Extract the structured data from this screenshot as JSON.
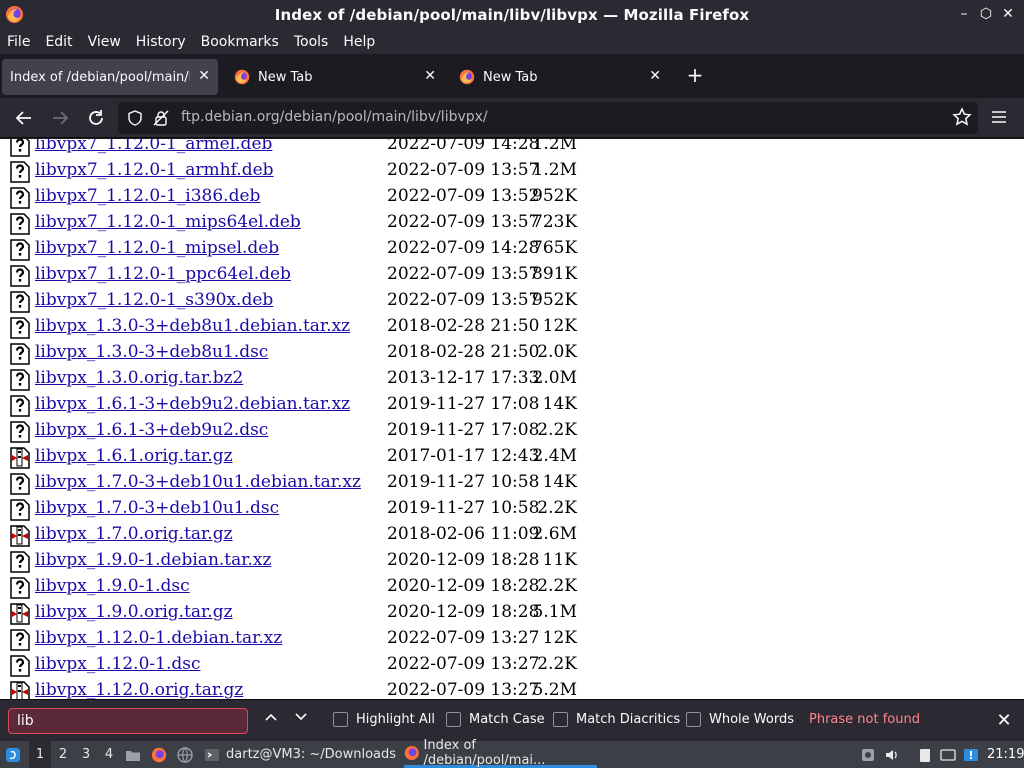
{
  "window": {
    "title": "Index of /debian/pool/main/libv/libvpx — Mozilla Firefox",
    "controls": [
      "–",
      "⬡",
      "✕"
    ]
  },
  "menu": [
    "File",
    "Edit",
    "View",
    "History",
    "Bookmarks",
    "Tools",
    "Help"
  ],
  "tabs": [
    {
      "label": "Index of /debian/pool/main/libv",
      "active": true
    },
    {
      "label": "New Tab",
      "active": false
    },
    {
      "label": "New Tab",
      "active": false
    }
  ],
  "urlbar": {
    "host": "ftp.debian.org",
    "path": "/debian/pool/main/libv/libvpx/"
  },
  "listing": [
    {
      "name": "libvpx7_1.12.0-1_armel.deb",
      "date": "2022-07-09 14:28",
      "size": "1.2M",
      "type": "unknown"
    },
    {
      "name": "libvpx7_1.12.0-1_armhf.deb",
      "date": "2022-07-09 13:57",
      "size": "1.2M",
      "type": "unknown"
    },
    {
      "name": "libvpx7_1.12.0-1_i386.deb",
      "date": "2022-07-09 13:52",
      "size": "952K",
      "type": "unknown"
    },
    {
      "name": "libvpx7_1.12.0-1_mips64el.deb",
      "date": "2022-07-09 13:57",
      "size": "723K",
      "type": "unknown"
    },
    {
      "name": "libvpx7_1.12.0-1_mipsel.deb",
      "date": "2022-07-09 14:28",
      "size": "765K",
      "type": "unknown"
    },
    {
      "name": "libvpx7_1.12.0-1_ppc64el.deb",
      "date": "2022-07-09 13:57",
      "size": "891K",
      "type": "unknown"
    },
    {
      "name": "libvpx7_1.12.0-1_s390x.deb",
      "date": "2022-07-09 13:57",
      "size": "952K",
      "type": "unknown"
    },
    {
      "name": "libvpx_1.3.0-3+deb8u1.debian.tar.xz",
      "date": "2018-02-28 21:50",
      "size": "12K",
      "type": "unknown"
    },
    {
      "name": "libvpx_1.3.0-3+deb8u1.dsc",
      "date": "2018-02-28 21:50",
      "size": "2.0K",
      "type": "unknown"
    },
    {
      "name": "libvpx_1.3.0.orig.tar.bz2",
      "date": "2013-12-17 17:33",
      "size": "2.0M",
      "type": "unknown"
    },
    {
      "name": "libvpx_1.6.1-3+deb9u2.debian.tar.xz",
      "date": "2019-11-27 17:08",
      "size": "14K",
      "type": "unknown"
    },
    {
      "name": "libvpx_1.6.1-3+deb9u2.dsc",
      "date": "2019-11-27 17:08",
      "size": "2.2K",
      "type": "unknown"
    },
    {
      "name": "libvpx_1.6.1.orig.tar.gz",
      "date": "2017-01-17 12:43",
      "size": "2.4M",
      "type": "archive"
    },
    {
      "name": "libvpx_1.7.0-3+deb10u1.debian.tar.xz",
      "date": "2019-11-27 10:58",
      "size": "14K",
      "type": "unknown"
    },
    {
      "name": "libvpx_1.7.0-3+deb10u1.dsc",
      "date": "2019-11-27 10:58",
      "size": "2.2K",
      "type": "unknown"
    },
    {
      "name": "libvpx_1.7.0.orig.tar.gz",
      "date": "2018-02-06 11:09",
      "size": "2.6M",
      "type": "archive"
    },
    {
      "name": "libvpx_1.9.0-1.debian.tar.xz",
      "date": "2020-12-09 18:28",
      "size": "11K",
      "type": "unknown"
    },
    {
      "name": "libvpx_1.9.0-1.dsc",
      "date": "2020-12-09 18:28",
      "size": "2.2K",
      "type": "unknown"
    },
    {
      "name": "libvpx_1.9.0.orig.tar.gz",
      "date": "2020-12-09 18:28",
      "size": "5.1M",
      "type": "archive"
    },
    {
      "name": "libvpx_1.12.0-1.debian.tar.xz",
      "date": "2022-07-09 13:27",
      "size": "12K",
      "type": "unknown"
    },
    {
      "name": "libvpx_1.12.0-1.dsc",
      "date": "2022-07-09 13:27",
      "size": "2.2K",
      "type": "unknown"
    },
    {
      "name": "libvpx_1.12.0.orig.tar.gz",
      "date": "2022-07-09 13:27",
      "size": "5.2M",
      "type": "archive"
    }
  ],
  "findbar": {
    "query": "lib",
    "options": [
      "Highlight All",
      "Match Case",
      "Match Diacritics",
      "Whole Words"
    ],
    "status": "Phrase not found"
  },
  "taskbar": {
    "workspaces": [
      "1",
      "2",
      "3",
      "4"
    ],
    "windows": [
      {
        "label": "dartz@VM3: ~/Downloads",
        "active": false
      },
      {
        "label": "Index of /debian/pool/mai...",
        "active": true
      }
    ],
    "clock": "21:19"
  },
  "colors": {
    "link": "#1b0ba6",
    "find_error": "#ff848b",
    "chrome_bg": "#2b2a33"
  }
}
